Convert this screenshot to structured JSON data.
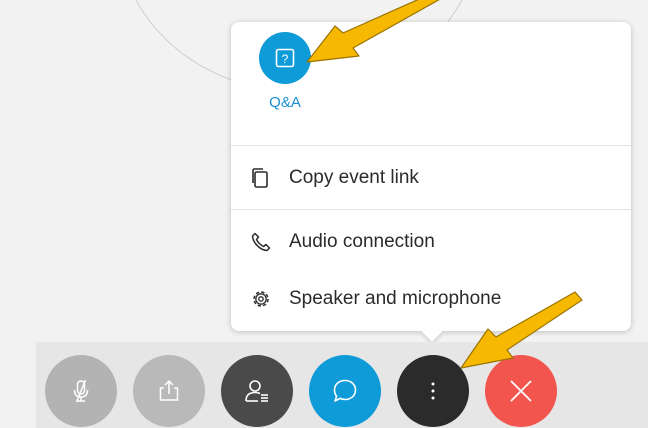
{
  "popup": {
    "qa": {
      "label": "Q&A",
      "icon": "question-mark-icon",
      "color": "#0e9bd8"
    },
    "items": [
      {
        "label": "Copy event link",
        "icon": "copy-icon"
      },
      {
        "label": "Audio connection",
        "icon": "phone-icon"
      },
      {
        "label": "Speaker and microphone",
        "icon": "gear-icon"
      }
    ]
  },
  "toolbar": {
    "buttons": [
      {
        "name": "mute",
        "icon": "microphone-muted-icon",
        "color": "#b3b3b3",
        "state": "disabled"
      },
      {
        "name": "share",
        "icon": "share-icon",
        "color": "#b9b9b9",
        "state": "disabled"
      },
      {
        "name": "participants",
        "icon": "participants-icon",
        "color": "#4a4a4a"
      },
      {
        "name": "chat",
        "icon": "chat-icon",
        "color": "#0e9bd8"
      },
      {
        "name": "more",
        "icon": "more-options-icon",
        "color": "#2b2b2b",
        "state": "active"
      },
      {
        "name": "leave",
        "icon": "close-icon",
        "color": "#f2554d"
      }
    ]
  },
  "annotations": {
    "arrow_color": "#f6b800"
  }
}
